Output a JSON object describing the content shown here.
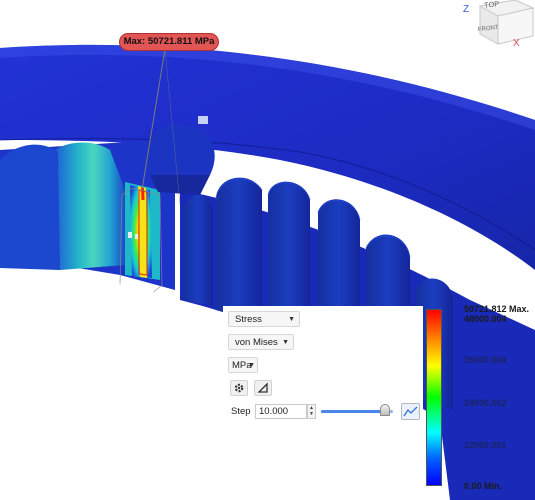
{
  "probe": {
    "max_label": "Max: 50721.811 MPa"
  },
  "viewcube": {
    "top": "TOP",
    "front": "FRONT",
    "axis_z": "Z",
    "axis_x": "X"
  },
  "controls": {
    "result_type": "Stress",
    "component": "von Mises",
    "unit": "MPa",
    "step_label": "Step",
    "step_value": "10.000",
    "step_slider_fraction": 0.9
  },
  "legend": {
    "max_label": "50721.812 Max.",
    "ticks": [
      "48000.004",
      "36000.004",
      "24000.002",
      "12000.001",
      "0.00 Min."
    ]
  },
  "icons": {
    "settings": "gear-icon",
    "triangle": "triangle-icon",
    "graph": "graph-icon",
    "caret": "caret-down-icon"
  },
  "colors": {
    "model_blue": "#1c2ec9",
    "hotspot_red": "#ff1a00",
    "probe_red": "#e25555",
    "slider_blue": "#4a86e8"
  }
}
